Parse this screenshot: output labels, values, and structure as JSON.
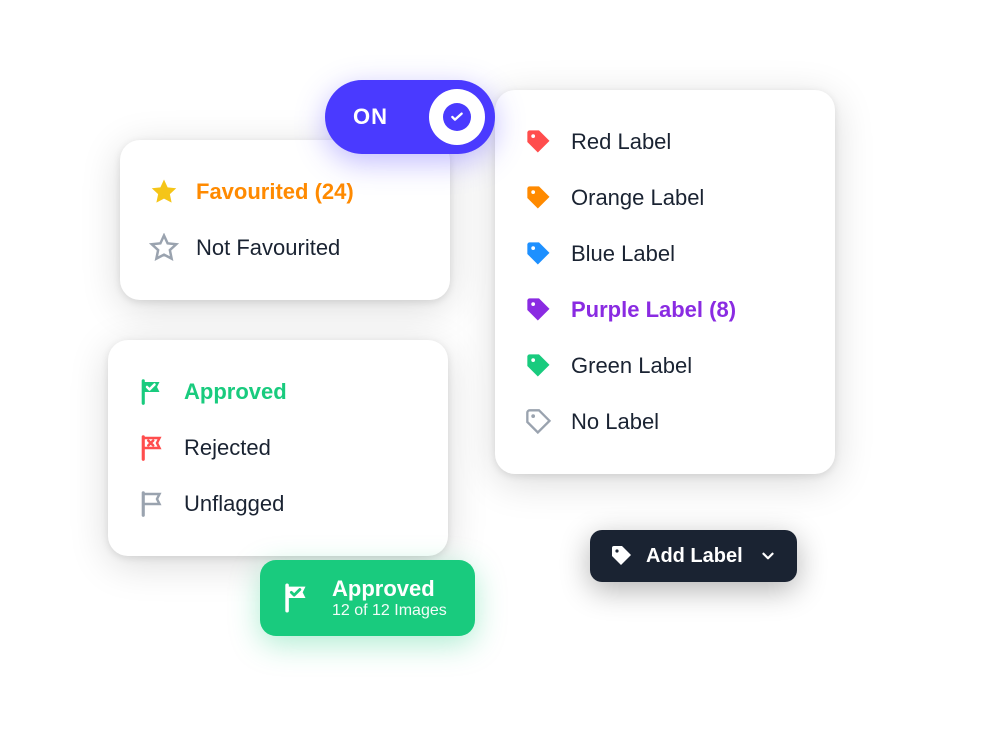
{
  "toggle": {
    "state": "ON"
  },
  "favourites": {
    "favourited": "Favourited (24)",
    "not_favourited": "Not Favourited"
  },
  "flags": {
    "approved": "Approved",
    "rejected": "Rejected",
    "unflagged": "Unflagged"
  },
  "approved_badge": {
    "title": "Approved",
    "subtitle": "12 of 12 Images"
  },
  "labels": {
    "red": "Red Label",
    "orange": "Orange Label",
    "blue": "Blue Label",
    "purple": "Purple Label (8)",
    "green": "Green Label",
    "none": "No Label"
  },
  "addlabel": {
    "text": "Add Label"
  },
  "colors": {
    "accent_purple": "#4a3aff",
    "star_yellow": "#f5c518",
    "orange": "#ff8a00",
    "red": "#ff4d4d",
    "blue": "#1e90ff",
    "purple": "#8a2be2",
    "green": "#19cb7e",
    "grey": "#9aa3af",
    "dark": "#1a2332"
  }
}
